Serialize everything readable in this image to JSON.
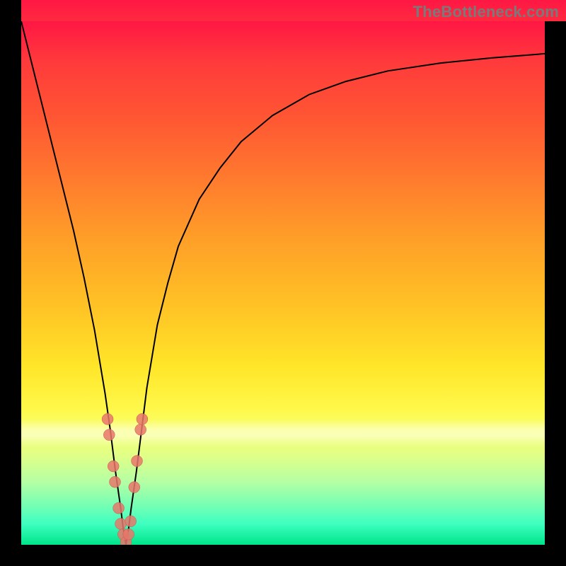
{
  "watermark": "TheBottleneck.com",
  "colors": {
    "gradient_top": "#ff1744",
    "gradient_bottom": "#00e58a",
    "curve": "#000000",
    "marker_fill": "#e8776b",
    "marker_stroke": "#c95a4e",
    "frame": "#000000"
  },
  "chart_data": {
    "type": "line",
    "title": "",
    "xlabel": "",
    "ylabel": "",
    "xlim": [
      0,
      100
    ],
    "ylim": [
      0,
      100
    ],
    "grid": false,
    "legend": null,
    "series": [
      {
        "name": "bottleneck-curve",
        "x": [
          0,
          2,
          4,
          6,
          8,
          10,
          12,
          14,
          16,
          17,
          18,
          19,
          19.5,
          20,
          20.5,
          21,
          22,
          23,
          24,
          26,
          28,
          30,
          34,
          38,
          42,
          48,
          55,
          62,
          70,
          80,
          90,
          100
        ],
        "y": [
          100,
          92,
          84,
          76,
          68,
          60,
          51,
          41,
          29,
          22,
          14,
          7,
          3,
          0,
          3,
          7,
          14,
          22,
          30,
          42,
          50,
          57,
          66,
          72,
          77,
          82,
          86,
          88.5,
          90.5,
          92,
          93,
          93.8
        ]
      }
    ],
    "markers": [
      {
        "x": 16.5,
        "y": 24
      },
      {
        "x": 16.8,
        "y": 21
      },
      {
        "x": 17.6,
        "y": 15
      },
      {
        "x": 17.9,
        "y": 12
      },
      {
        "x": 18.6,
        "y": 7
      },
      {
        "x": 19.0,
        "y": 4
      },
      {
        "x": 19.5,
        "y": 2
      },
      {
        "x": 20.0,
        "y": 0.5
      },
      {
        "x": 20.5,
        "y": 2
      },
      {
        "x": 20.9,
        "y": 4.5
      },
      {
        "x": 21.6,
        "y": 11
      },
      {
        "x": 22.1,
        "y": 16
      },
      {
        "x": 22.8,
        "y": 22
      },
      {
        "x": 23.1,
        "y": 24
      }
    ],
    "white_band_y_range": [
      19,
      24
    ]
  }
}
